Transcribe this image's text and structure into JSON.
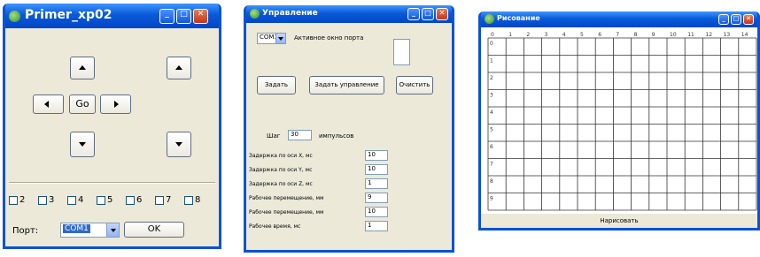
{
  "window1": {
    "title": "Primer_xp02",
    "go_label": "Go",
    "checkbox_labels": [
      "2",
      "3",
      "4",
      "5",
      "6",
      "7",
      "8"
    ],
    "port_label": "Порт:",
    "port_value": "COM1",
    "ok_label": "OK"
  },
  "window2": {
    "title": "Управление",
    "combo_value": "COM1",
    "active_label": "Активное окно порта",
    "buttons": {
      "left": "Задать",
      "middle": "Задать управление",
      "right": "Очистить"
    },
    "steps_label": "Шаг",
    "steps_value": "30",
    "steps_unit": "импульсов",
    "params": [
      {
        "label": "Задержка по оси X, мс",
        "value": "10"
      },
      {
        "label": "Задержка по оси Y, мс",
        "value": "10"
      },
      {
        "label": "Задержка по оси Z, мс",
        "value": "1"
      },
      {
        "label": "Рабочее перемещение, мм",
        "value": "9"
      },
      {
        "label": "Рабочее перемещение, мм",
        "value": "10"
      },
      {
        "label": "Рабочее время, мс",
        "value": "1"
      }
    ]
  },
  "window3": {
    "title": "Рисование",
    "col_labels": [
      "0",
      "1",
      "2",
      "3",
      "4",
      "5",
      "6",
      "7",
      "8",
      "9",
      "10",
      "11",
      "12",
      "13",
      "14"
    ],
    "row_labels": [
      "0",
      "1",
      "2",
      "3",
      "4",
      "5",
      "6",
      "7",
      "8",
      "9"
    ],
    "footer": "Нарисовать"
  }
}
